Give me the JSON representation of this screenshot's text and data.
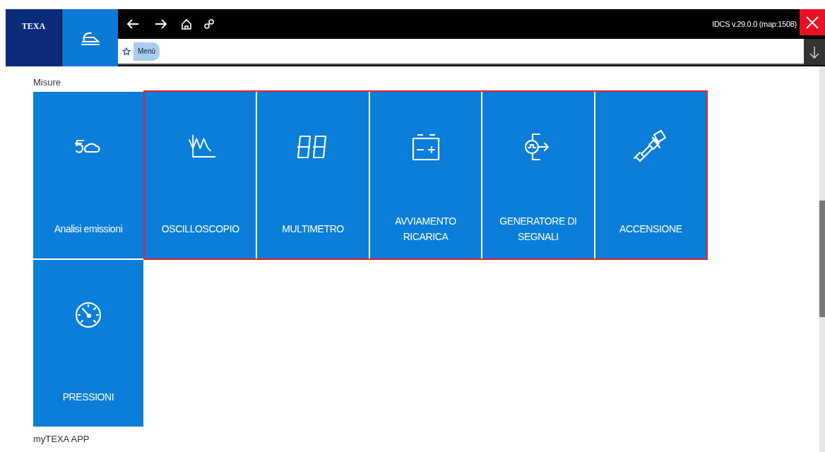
{
  "header": {
    "logo": "TEXA",
    "version": "IDCS v.29.0.0 (map:1508)",
    "breadcrumb": [
      "Menù"
    ]
  },
  "sections": [
    {
      "title": "Misure",
      "tiles": [
        {
          "label": "Analisi emissioni",
          "kind": "emissions",
          "highlighted": false
        },
        {
          "label": "OSCILLOSCOPIO",
          "kind": "scope",
          "highlighted": true
        },
        {
          "label": "MULTIMETRO",
          "kind": "digits",
          "highlighted": true
        },
        {
          "label": "AVVIAMENTO RICARICA",
          "kind": "battery",
          "highlighted": true
        },
        {
          "label": "GENERATORE DI SEGNALI",
          "kind": "generator",
          "highlighted": true
        },
        {
          "label": "ACCENSIONE",
          "kind": "plug",
          "highlighted": true
        },
        {
          "label": "PRESSIONI",
          "kind": "gauge",
          "highlighted": false
        }
      ]
    },
    {
      "title": "myTEXA APP"
    }
  ]
}
